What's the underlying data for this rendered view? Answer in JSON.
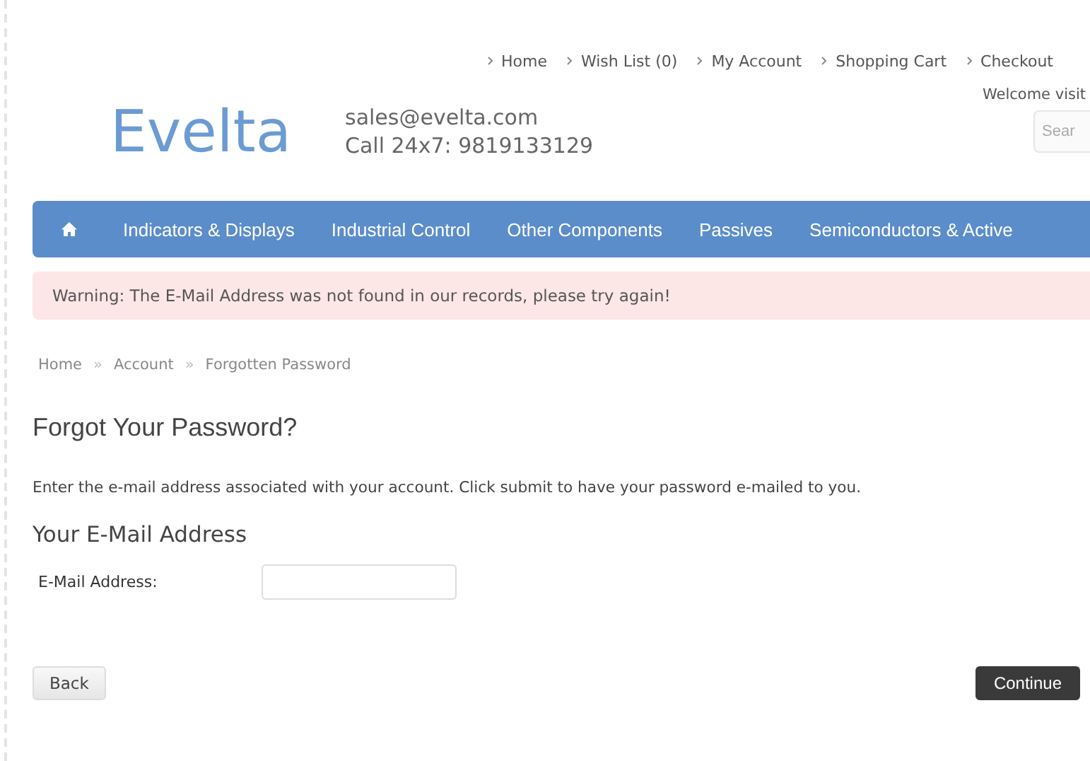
{
  "top_links": [
    "Home",
    "Wish List (0)",
    "My Account",
    "Shopping Cart",
    "Checkout"
  ],
  "welcome": "Welcome visit",
  "search": {
    "placeholder": "Sear"
  },
  "logo": "Evelta",
  "contact": {
    "email": "sales@evelta.com",
    "phone": "Call 24x7: 9819133129"
  },
  "nav": [
    "Indicators & Displays",
    "Industrial Control",
    "Other Components",
    "Passives",
    "Semiconductors & Active"
  ],
  "warning": "Warning: The E-Mail Address was not found in our records, please try again!",
  "breadcrumb": [
    "Home",
    "Account",
    "Forgotten Password"
  ],
  "breadcrumb_separator": "»",
  "title": "Forgot Your Password?",
  "intro": "Enter the e-mail address associated with your account. Click submit to have your password e-mailed to you.",
  "section": "Your E-Mail Address",
  "field": {
    "label": "E-Mail Address:"
  },
  "buttons": {
    "back": "Back",
    "continue": "Continue"
  }
}
